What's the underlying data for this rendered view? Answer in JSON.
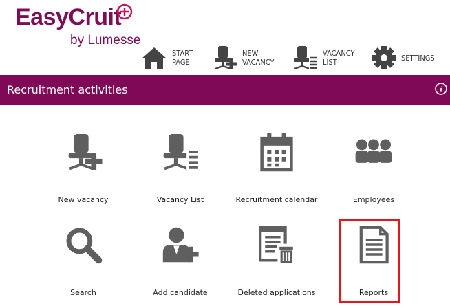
{
  "header": {
    "logo_main": "EasyCruit",
    "logo_sub": "by Lumesse",
    "nav": [
      {
        "line1": "START",
        "line2": "PAGE",
        "icon": "home-icon"
      },
      {
        "line1": "NEW",
        "line2": "VACANCY",
        "icon": "new-vacancy-icon"
      },
      {
        "line1": "VACANCY",
        "line2": "LIST",
        "icon": "vacancy-list-icon"
      },
      {
        "line1": "SETTINGS",
        "line2": "",
        "icon": "gear-icon"
      }
    ]
  },
  "section": {
    "title": "Recruitment activities",
    "info_icon": "info-icon",
    "color": "#800957"
  },
  "tiles": [
    {
      "label": "New vacancy",
      "icon": "new-vacancy-icon"
    },
    {
      "label": "Vacancy List",
      "icon": "vacancy-list-icon"
    },
    {
      "label": "Recruitment calendar",
      "icon": "calendar-icon"
    },
    {
      "label": "Employees",
      "icon": "employees-icon"
    },
    {
      "label": "Search",
      "icon": "search-icon"
    },
    {
      "label": "Add candidate",
      "icon": "add-candidate-icon"
    },
    {
      "label": "Deleted applications",
      "icon": "deleted-applications-icon"
    },
    {
      "label": "Reports",
      "icon": "reports-icon"
    }
  ],
  "highlight_color": "#e8161c"
}
